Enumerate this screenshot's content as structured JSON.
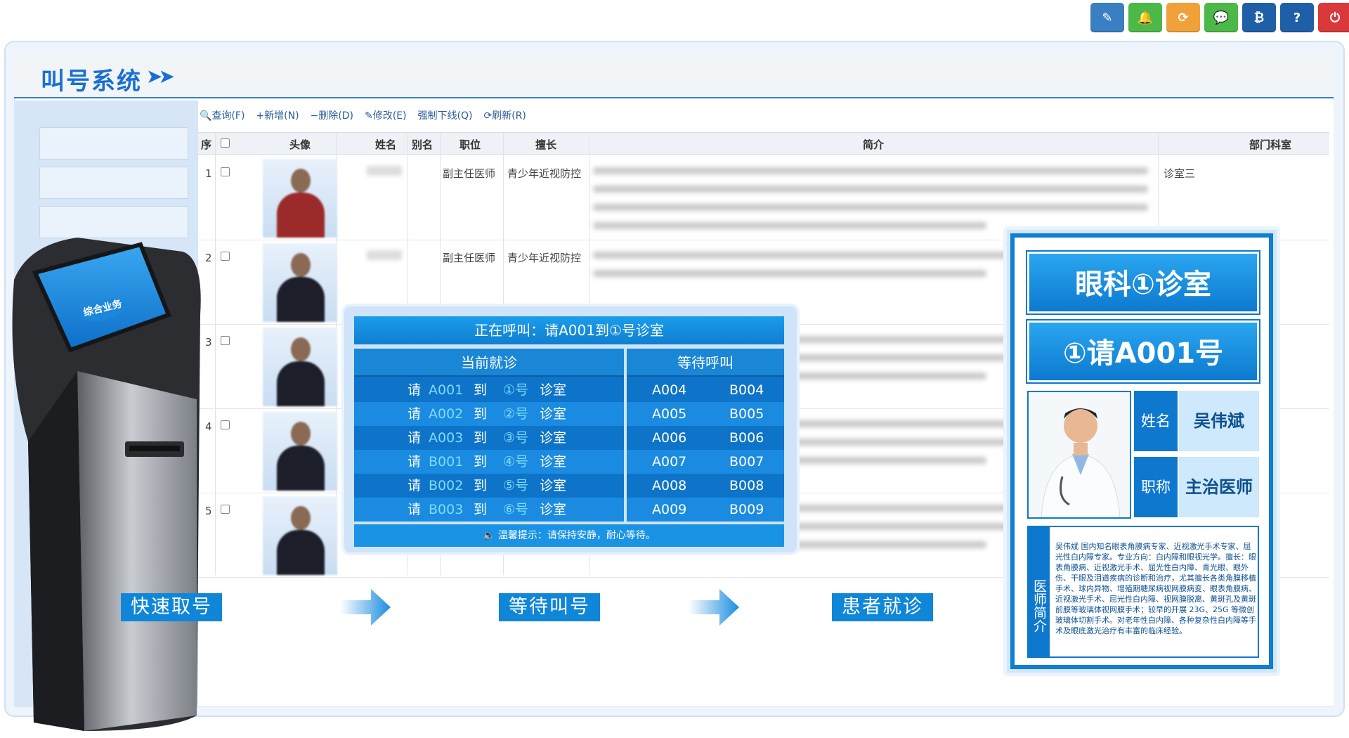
{
  "app": {
    "title": "叫号系统",
    "title_arrows": "➤➤"
  },
  "toolbar": [
    {
      "icon": "edit-icon",
      "glyph": "✎",
      "color": "#3a7fc1"
    },
    {
      "icon": "bell-icon",
      "glyph": "🔔",
      "color": "#4cb848"
    },
    {
      "icon": "refresh-icon",
      "glyph": "⟳",
      "color": "#f0a13a"
    },
    {
      "icon": "wechat-icon",
      "glyph": "💬",
      "color": "#4cb848"
    },
    {
      "icon": "bitcoin-icon",
      "glyph": "₿",
      "color": "#1f5fa8"
    },
    {
      "icon": "help-icon",
      "glyph": "?",
      "color": "#1f5fa8"
    },
    {
      "icon": "logout-icon",
      "glyph": "⏻",
      "color": "#d9393b"
    }
  ],
  "grid": {
    "tools": {
      "query": "查询(F)",
      "add": "新增(N)",
      "delete": "删除(D)",
      "edit": "修改(E)",
      "force_offline": "强制下线(Q)",
      "refresh": "刷新(R)"
    },
    "columns": {
      "index": "序",
      "avatar": "头像",
      "name": "姓名",
      "alias": "别名",
      "position": "职位",
      "specialty": "擅长",
      "intro": "简介",
      "department": "部门科室"
    },
    "rows": [
      {
        "index": "1",
        "position": "副主任医师",
        "specialty": "青少年近视防控",
        "department": "诊室三"
      },
      {
        "index": "2",
        "position": "副主任医师",
        "specialty": "青少年近视防控",
        "department": ""
      },
      {
        "index": "3",
        "position": "",
        "specialty": "",
        "department": ""
      },
      {
        "index": "4",
        "position": "",
        "specialty": "",
        "department": ""
      },
      {
        "index": "5",
        "position": "",
        "specialty": "",
        "department": ""
      }
    ]
  },
  "kiosk": {
    "screen_title": "综合业务"
  },
  "callboard": {
    "heading": "正在呼叫：请A001到①号诊室",
    "current_header": "当前就诊",
    "waiting_header": "等待呼叫",
    "current": [
      {
        "pre": "请",
        "num": "A001",
        "to": "到",
        "room": "①号",
        "suffix": "诊室"
      },
      {
        "pre": "请",
        "num": "A002",
        "to": "到",
        "room": "②号",
        "suffix": "诊室"
      },
      {
        "pre": "请",
        "num": "A003",
        "to": "到",
        "room": "③号",
        "suffix": "诊室"
      },
      {
        "pre": "请",
        "num": "B001",
        "to": "到",
        "room": "④号",
        "suffix": "诊室"
      },
      {
        "pre": "请",
        "num": "B002",
        "to": "到",
        "room": "⑤号",
        "suffix": "诊室"
      },
      {
        "pre": "请",
        "num": "B003",
        "to": "到",
        "room": "⑥号",
        "suffix": "诊室"
      }
    ],
    "waiting": [
      {
        "a": "A004",
        "b": "B004"
      },
      {
        "a": "A005",
        "b": "B005"
      },
      {
        "a": "A006",
        "b": "B006"
      },
      {
        "a": "A007",
        "b": "B007"
      },
      {
        "a": "A008",
        "b": "B008"
      },
      {
        "a": "A009",
        "b": "B009"
      }
    ],
    "footer": "🔈 温馨提示：请保持安静，耐心等待。"
  },
  "doctor": {
    "room": "眼科①诊室",
    "number": "①请A001号",
    "name_label": "姓名",
    "name": "吴伟斌",
    "title_label": "职称",
    "title": "主治医师",
    "bio_title": "医师简介",
    "bio": "吴伟斌 国内知名眼表角膜病专家、近视激光手术专家、屈光性白内障专家。专业方向：白内障和眼视光学。擅长：眼表角膜病、近视激光手术、屈光性白内障、青光眼、眼外伤、干眼及泪道疾病的诊断和治疗，尤其擅长各类角膜移植手术、球内异物、增殖期糖尿病视网膜病变、眼表角膜病、近视激光手术、屈光性白内障、视网膜脱离、黄斑孔及黄斑前膜等玻璃体视网膜手术；较早的开展 23G、25G 等微创玻璃体切割手术。对老年性白内障、各种复杂性白内障等手术及眼底激光治疗有丰富的临床经验。"
  },
  "steps": {
    "take_number": "快速取号",
    "wait_call": "等待叫号",
    "visit": "患者就诊"
  }
}
